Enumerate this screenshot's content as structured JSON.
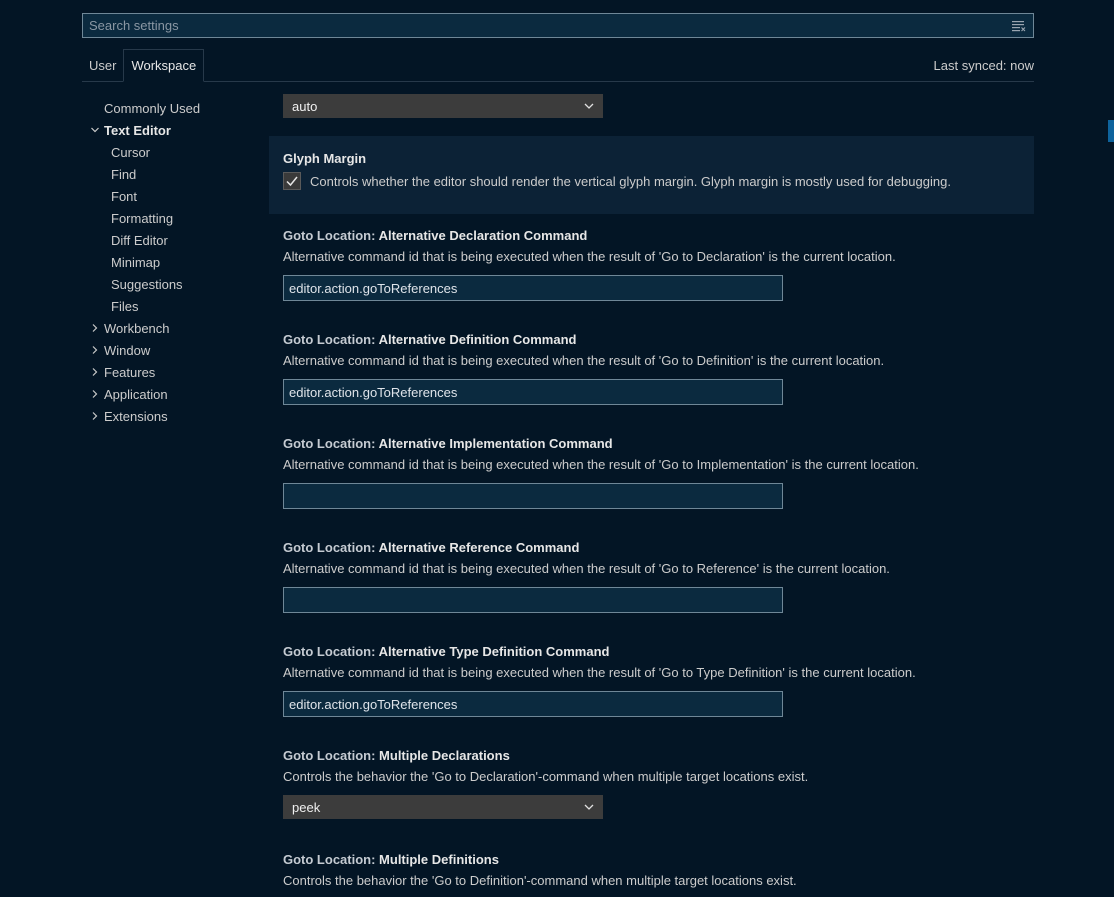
{
  "search": {
    "placeholder": "Search settings",
    "icon": "filter-icon"
  },
  "tabs": [
    {
      "label": "User",
      "active": false
    },
    {
      "label": "Workspace",
      "active": true
    }
  ],
  "sync_status": "Last synced: now",
  "toc": {
    "items": [
      {
        "label": "Commonly Used",
        "type": "root",
        "chevron": "none"
      },
      {
        "label": "Text Editor",
        "type": "root",
        "chevron": "down",
        "bold": true
      },
      {
        "label": "Cursor",
        "type": "child"
      },
      {
        "label": "Find",
        "type": "child"
      },
      {
        "label": "Font",
        "type": "child"
      },
      {
        "label": "Formatting",
        "type": "child"
      },
      {
        "label": "Diff Editor",
        "type": "child"
      },
      {
        "label": "Minimap",
        "type": "child"
      },
      {
        "label": "Suggestions",
        "type": "child"
      },
      {
        "label": "Files",
        "type": "child"
      },
      {
        "label": "Workbench",
        "type": "root",
        "chevron": "right"
      },
      {
        "label": "Window",
        "type": "root",
        "chevron": "right"
      },
      {
        "label": "Features",
        "type": "root",
        "chevron": "right"
      },
      {
        "label": "Application",
        "type": "root",
        "chevron": "right"
      },
      {
        "label": "Extensions",
        "type": "root",
        "chevron": "right"
      }
    ]
  },
  "settings": {
    "top_select": {
      "value": "auto"
    },
    "glyph_margin": {
      "title": "Glyph Margin",
      "checked": true,
      "description": "Controls whether the editor should render the vertical glyph margin. Glyph margin is mostly used for debugging."
    },
    "alt_declaration": {
      "category": "Goto Location: ",
      "name": "Alternative Declaration Command",
      "description": "Alternative command id that is being executed when the result of 'Go to Declaration' is the current location.",
      "value": "editor.action.goToReferences"
    },
    "alt_definition": {
      "category": "Goto Location: ",
      "name": "Alternative Definition Command",
      "description": "Alternative command id that is being executed when the result of 'Go to Definition' is the current location.",
      "value": "editor.action.goToReferences"
    },
    "alt_implementation": {
      "category": "Goto Location: ",
      "name": "Alternative Implementation Command",
      "description": "Alternative command id that is being executed when the result of 'Go to Implementation' is the current location.",
      "value": ""
    },
    "alt_reference": {
      "category": "Goto Location: ",
      "name": "Alternative Reference Command",
      "description": "Alternative command id that is being executed when the result of 'Go to Reference' is the current location.",
      "value": ""
    },
    "alt_type_definition": {
      "category": "Goto Location: ",
      "name": "Alternative Type Definition Command",
      "description": "Alternative command id that is being executed when the result of 'Go to Type Definition' is the current location.",
      "value": "editor.action.goToReferences"
    },
    "multiple_declarations": {
      "category": "Goto Location: ",
      "name": "Multiple Declarations",
      "description": "Controls the behavior the 'Go to Declaration'-command when multiple target locations exist.",
      "value": "peek"
    },
    "multiple_definitions": {
      "category": "Goto Location: ",
      "name": "Multiple Definitions",
      "description": "Controls the behavior the 'Go to Definition'-command when multiple target locations exist."
    }
  },
  "colors": {
    "background": "#031525",
    "input_bg": "#0b2a3f",
    "select_bg": "#3c3c3c",
    "focused_row": "#0c2236",
    "accent": "#0e639c"
  }
}
